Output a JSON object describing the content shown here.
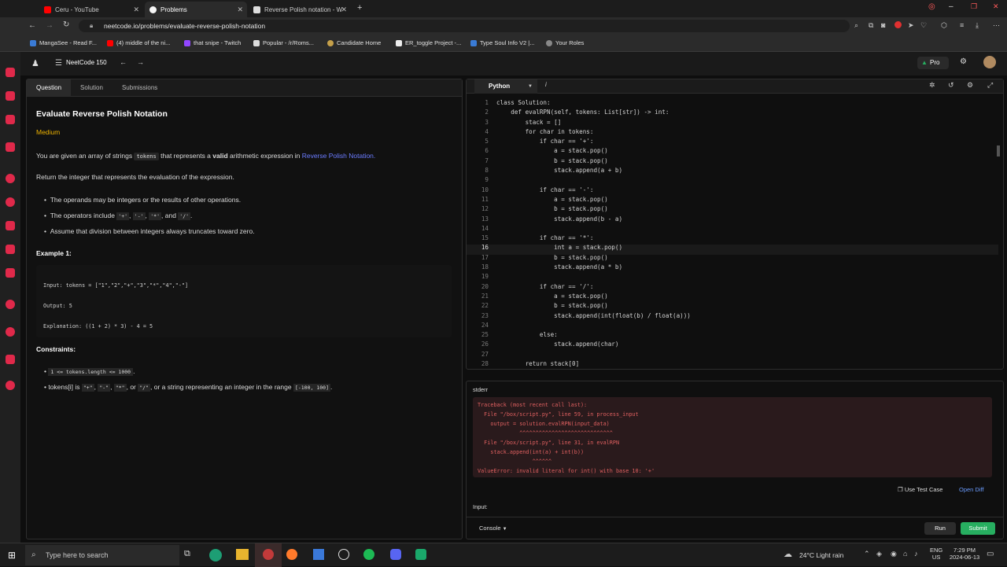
{
  "browser": {
    "tabs": [
      {
        "label": "Ceru - YouTube",
        "color": "#ff0000"
      },
      {
        "label": "Problems",
        "color": "#ffffff"
      },
      {
        "label": "Reverse Polish notation - W",
        "color": "#ffffff"
      }
    ],
    "url": "neetcode.io/problems/evaluate-reverse-polish-notation",
    "bookmarks": [
      "MangaSee - Read F...",
      "(4) middle of the ni...",
      "that snipe - Twitch",
      "Popular - /r/Roms...",
      "Candidate Home",
      "ER_toggle Project -...",
      "Type Soul Info V2 |...",
      "Your Roles"
    ]
  },
  "app": {
    "brand": "NeetCode 150",
    "pro_label": "Pro"
  },
  "left": {
    "tabs": [
      "Question",
      "Solution",
      "Submissions"
    ],
    "title": "Evaluate Reverse Polish Notation",
    "difficulty": "Medium",
    "intro_a": "You are given an array of strings",
    "intro_code": "tokens",
    "intro_b": "that represents a",
    "intro_bold": "valid",
    "intro_c": "arithmetic expression in",
    "intro_link": "Reverse Polish Notation.",
    "return_text": "Return the integer that represents the evaluation of the expression.",
    "bullet1": "The operands may be integers or the results of other operations.",
    "bullet2_a": "The operators include",
    "bullet2_c1": "'+'",
    "bullet2_c2": "'-'",
    "bullet2_c3": "'*'",
    "bullet2_and": ", and",
    "bullet2_c4": "'/'",
    "bullet3": "Assume that division between integers always truncates toward zero.",
    "example_title": "Example 1:",
    "ex_input": "Input: tokens = [\"1\",\"2\",\"+\",\"3\",\"*\",\"4\",\"-\"]",
    "ex_output": "Output: 5",
    "ex_expl": "Explanation: ((1 + 2) * 3) - 4 = 5",
    "constraints_title": "Constraints:",
    "c1": "1 <= tokens.length <= 1000",
    "c2_a": "tokens[i] is",
    "c2_c1": "\"+\"",
    "c2_c2": "\"-\"",
    "c2_c3": "\"*\"",
    "c2_or": ", or",
    "c2_c4": "\"/\"",
    "c2_b": ", or a string representing an integer in the range",
    "c2_range": "[-100, 100]"
  },
  "editor": {
    "language": "Python",
    "lines": [
      "class Solution:",
      "    def evalRPN(self, tokens: List[str]) -> int:",
      "        stack = []",
      "        for char in tokens:",
      "            if char == '+':",
      "                a = stack.pop()",
      "                b = stack.pop()",
      "                stack.append(a + b)",
      "",
      "            if char == '-':",
      "                a = stack.pop()",
      "                b = stack.pop()",
      "                stack.append(b - a)",
      "",
      "            if char == '*':",
      "                int a = stack.pop()",
      "                b = stack.pop()",
      "                stack.append(a * b)",
      "",
      "            if char == '/':",
      "                a = stack.pop()",
      "                b = stack.pop()",
      "                stack.append(int(float(b) / float(a)))",
      "",
      "            else:",
      "                stack.append(char)",
      "",
      "        return stack[0]"
    ]
  },
  "output": {
    "stderr_label": "stderr",
    "trace": [
      "Traceback (most recent call last):",
      "  File \"/box/script.py\", line 59, in process_input",
      "    output = solution.evalRPN(input_data)",
      "             ^^^^^^^^^^^^^^^^^^^^^^^^^^^^^",
      "  File \"/box/script.py\", line 31, in evalRPN",
      "    stack.append(int(a) + int(b))",
      "                 ^^^^^^",
      "ValueError: invalid literal for int() with base 10: '+'"
    ],
    "use_test_case": "Use Test Case",
    "open_diff": "Open Diff",
    "input_label": "Input:",
    "console_label": "Console",
    "run_label": "Run",
    "submit_label": "Submit"
  },
  "taskbar": {
    "search_placeholder": "Type here to search",
    "weather": "24°C  Light rain",
    "lang": "ENG",
    "region": "US",
    "time": "7:29 PM",
    "date": "2024-06-13"
  },
  "colors": {
    "accent_green": "#27ae60",
    "link_blue": "#6b7cff",
    "medium": "#f0b400",
    "error_red": "#e06060"
  }
}
